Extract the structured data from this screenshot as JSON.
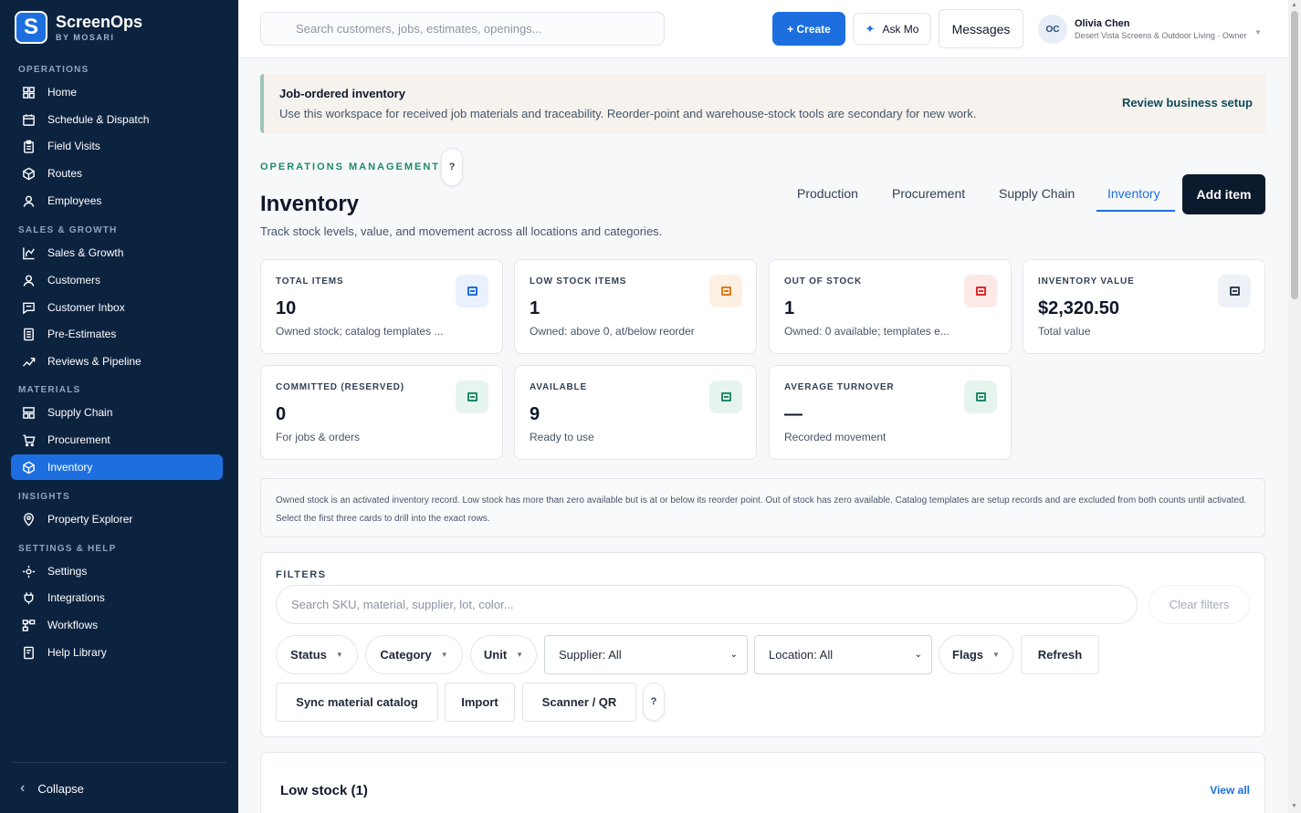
{
  "brand": {
    "name": "ScreenOps",
    "sub": "BY MOSARI",
    "logo_letter": "S"
  },
  "sidebar": {
    "sections": [
      {
        "label": "OPERATIONS"
      },
      {
        "label": "SALES & GROWTH"
      },
      {
        "label": "MATERIALS"
      },
      {
        "label": "INSIGHTS"
      },
      {
        "label": "SETTINGS & HELP"
      }
    ],
    "items": [
      {
        "label": "Home",
        "icon": "grid-icon"
      },
      {
        "label": "Schedule & Dispatch",
        "icon": "calendar-icon"
      },
      {
        "label": "Field Visits",
        "icon": "clipboard-icon"
      },
      {
        "label": "Routes",
        "icon": "cube-icon"
      },
      {
        "label": "Employees",
        "icon": "person-icon"
      },
      {
        "label": "Sales & Growth",
        "icon": "chart-bar-icon"
      },
      {
        "label": "Customers",
        "icon": "person-icon"
      },
      {
        "label": "Customer Inbox",
        "icon": "chat-icon"
      },
      {
        "label": "Pre-Estimates",
        "icon": "document-icon"
      },
      {
        "label": "Reviews & Pipeline",
        "icon": "trend-line-icon"
      },
      {
        "label": "Supply Chain",
        "icon": "boxes-icon"
      },
      {
        "label": "Procurement",
        "icon": "cart-icon"
      },
      {
        "label": "Inventory",
        "icon": "cube-icon"
      },
      {
        "label": "Property Explorer",
        "icon": "map-pin-icon"
      },
      {
        "label": "Settings",
        "icon": "sun-gear-icon"
      },
      {
        "label": "Integrations",
        "icon": "plug-icon"
      },
      {
        "label": "Workflows",
        "icon": "workflow-icon"
      },
      {
        "label": "Help Library",
        "icon": "book-icon"
      }
    ],
    "active_item": "Inventory",
    "collapse_label": "Collapse"
  },
  "topbar": {
    "search_placeholder": "Search customers, jobs, estimates, openings...",
    "create_label": "+ Create",
    "askmo_label": "Ask Mo",
    "messages_label": "Messages",
    "user": {
      "initials": "OC",
      "name": "Olivia Chen",
      "org": "Desert Vista Screens & Outdoor Living · Owner"
    }
  },
  "notice": {
    "title": "Job-ordered inventory",
    "text": "Use this workspace for received job materials and traceability. Reorder-point and warehouse-stock tools are secondary for new work.",
    "link": "Review business setup"
  },
  "header": {
    "eyebrow": "OPERATIONS MANAGEMENT",
    "help": "?",
    "title": "Inventory",
    "subtitle": "Track stock levels, value, and movement across all locations and categories.",
    "tabs": [
      "Production",
      "Procurement",
      "Supply Chain",
      "Inventory"
    ],
    "active_tab": "Inventory",
    "add_label": "Add item"
  },
  "stats": [
    {
      "label": "TOTAL ITEMS",
      "value": "10",
      "note": "Owned stock; catalog templates ...",
      "color": "#1d6fe0",
      "bg": "#e8f1fd"
    },
    {
      "label": "LOW STOCK ITEMS",
      "value": "1",
      "note": "Owned: above 0, at/below reorder",
      "color": "#e07a1d",
      "bg": "#fdf0e3"
    },
    {
      "label": "OUT OF STOCK",
      "value": "1",
      "note": "Owned: 0 available; templates e...",
      "color": "#d92b2b",
      "bg": "#fde8e8"
    },
    {
      "label": "INVENTORY VALUE",
      "value": "$2,320.50",
      "note": "Total value",
      "color": "#334155",
      "bg": "#eef1f5"
    },
    {
      "label": "COMMITTED (RESERVED)",
      "value": "0",
      "note": "For jobs & orders",
      "color": "#1f8a6a",
      "bg": "#e6f4ee"
    },
    {
      "label": "AVAILABLE",
      "value": "9",
      "note": "Ready to use",
      "color": "#1f8a6a",
      "bg": "#e6f4ee"
    },
    {
      "label": "AVERAGE TURNOVER",
      "value": "—",
      "note": "Recorded movement",
      "color": "#1f8a6a",
      "bg": "#e6f4ee"
    }
  ],
  "explain": "Owned stock is an activated inventory record. Low stock has more than zero available but is at or below its reorder point. Out of stock has zero available. Catalog templates are setup records and are excluded from both counts until activated. Select the first three cards to drill into the exact rows.",
  "filters": {
    "label": "FILTERS",
    "search_placeholder": "Search SKU, material, supplier, lot, color...",
    "clear_label": "Clear filters",
    "status": "Status",
    "category": "Category",
    "unit": "Unit",
    "supplier": "Supplier: All",
    "location": "Location: All",
    "flags": "Flags",
    "refresh": "Refresh",
    "sync": "Sync material catalog",
    "import": "Import",
    "scanner": "Scanner / QR",
    "help": "?"
  },
  "lowstock": {
    "title": "Low stock (1)",
    "link": "View all"
  }
}
